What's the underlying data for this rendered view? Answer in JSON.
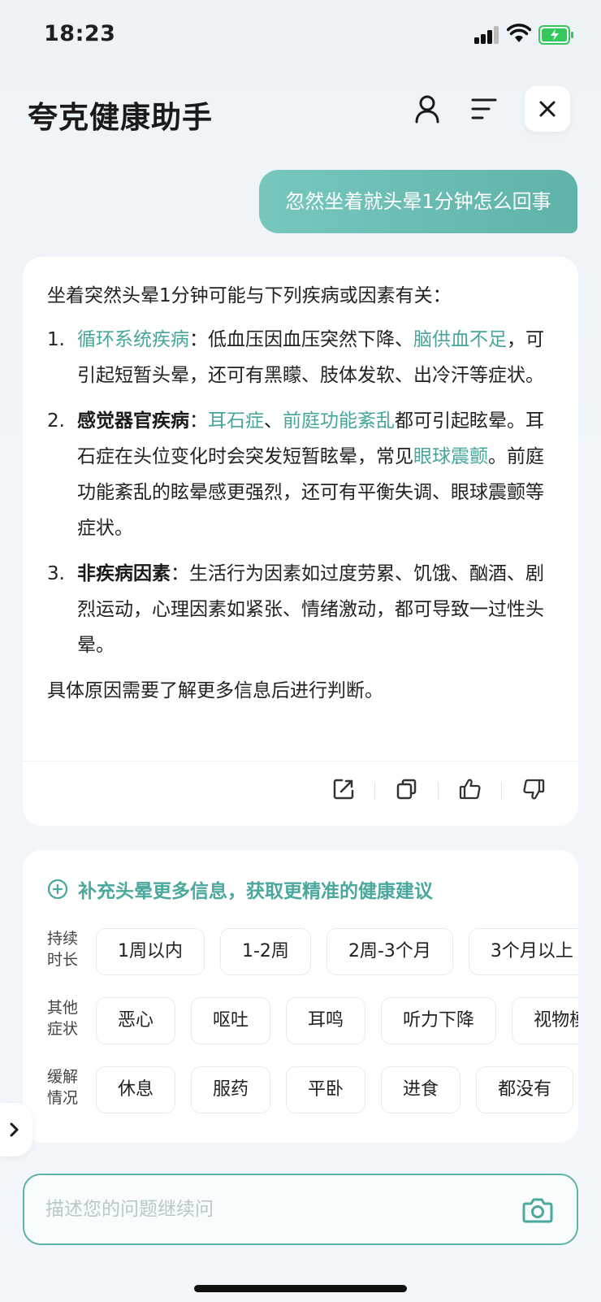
{
  "status_bar": {
    "time": "18:23"
  },
  "header": {
    "title": "夸克健康助手"
  },
  "conversation": {
    "user_message": "忽然坐着就头晕1分钟怎么回事",
    "answer": {
      "intro": "坐着突然头晕1分钟可能与下列疾病或因素有关：",
      "items": [
        {
          "num": "1.",
          "parts": [
            {
              "text": "循环系统疾病",
              "style": "link"
            },
            {
              "text": "：低血压因血压突然下降、",
              "style": "plain"
            },
            {
              "text": "脑供血不足",
              "style": "link"
            },
            {
              "text": "，可引起短暂头晕，还可有黑矇、肢体发软、出冷汗等症状。",
              "style": "plain"
            }
          ]
        },
        {
          "num": "2.",
          "parts": [
            {
              "text": "感觉器官疾病",
              "style": "bold"
            },
            {
              "text": "：",
              "style": "plain"
            },
            {
              "text": "耳石症",
              "style": "link"
            },
            {
              "text": "、",
              "style": "plain"
            },
            {
              "text": "前庭功能紊乱",
              "style": "link"
            },
            {
              "text": "都可引起眩晕。耳石症在头位变化时会突发短暂眩晕，常见",
              "style": "plain"
            },
            {
              "text": "眼球震颤",
              "style": "link"
            },
            {
              "text": "。前庭功能紊乱的眩晕感更强烈，还可有平衡失调、眼球震颤等症状。",
              "style": "plain"
            }
          ]
        },
        {
          "num": "3.",
          "parts": [
            {
              "text": "非疾病因素",
              "style": "bold"
            },
            {
              "text": "：生活行为因素如过度劳累、饥饿、酗酒、剧烈运动，心理因素如紧张、情绪激动，都可导致一过性头晕。",
              "style": "plain"
            }
          ]
        }
      ],
      "outro": "具体原因需要了解更多信息后进行判断。"
    }
  },
  "supplement": {
    "title": "补充头晕更多信息，获取更精准的健康建议",
    "rows": [
      {
        "label": "持续时长",
        "chips": [
          "1周以内",
          "1-2周",
          "2周-3个月",
          "3个月以上"
        ]
      },
      {
        "label": "其他症状",
        "chips": [
          "恶心",
          "呕吐",
          "耳鸣",
          "听力下降",
          "视物模糊"
        ]
      },
      {
        "label": "缓解情况",
        "chips": [
          "休息",
          "服药",
          "平卧",
          "进食",
          "都没有"
        ]
      }
    ]
  },
  "input": {
    "placeholder": "描述您的问题继续问"
  },
  "colors": {
    "accent": "#5fb3a9",
    "link": "#47a69b",
    "bubble": "#6cbdb3"
  },
  "icons": [
    "user-icon",
    "menu-icon",
    "close-icon",
    "edit-icon",
    "copy-icon",
    "thumb-up-icon",
    "thumb-down-icon",
    "plus-circle-icon",
    "chevron-right-icon",
    "camera-icon"
  ]
}
